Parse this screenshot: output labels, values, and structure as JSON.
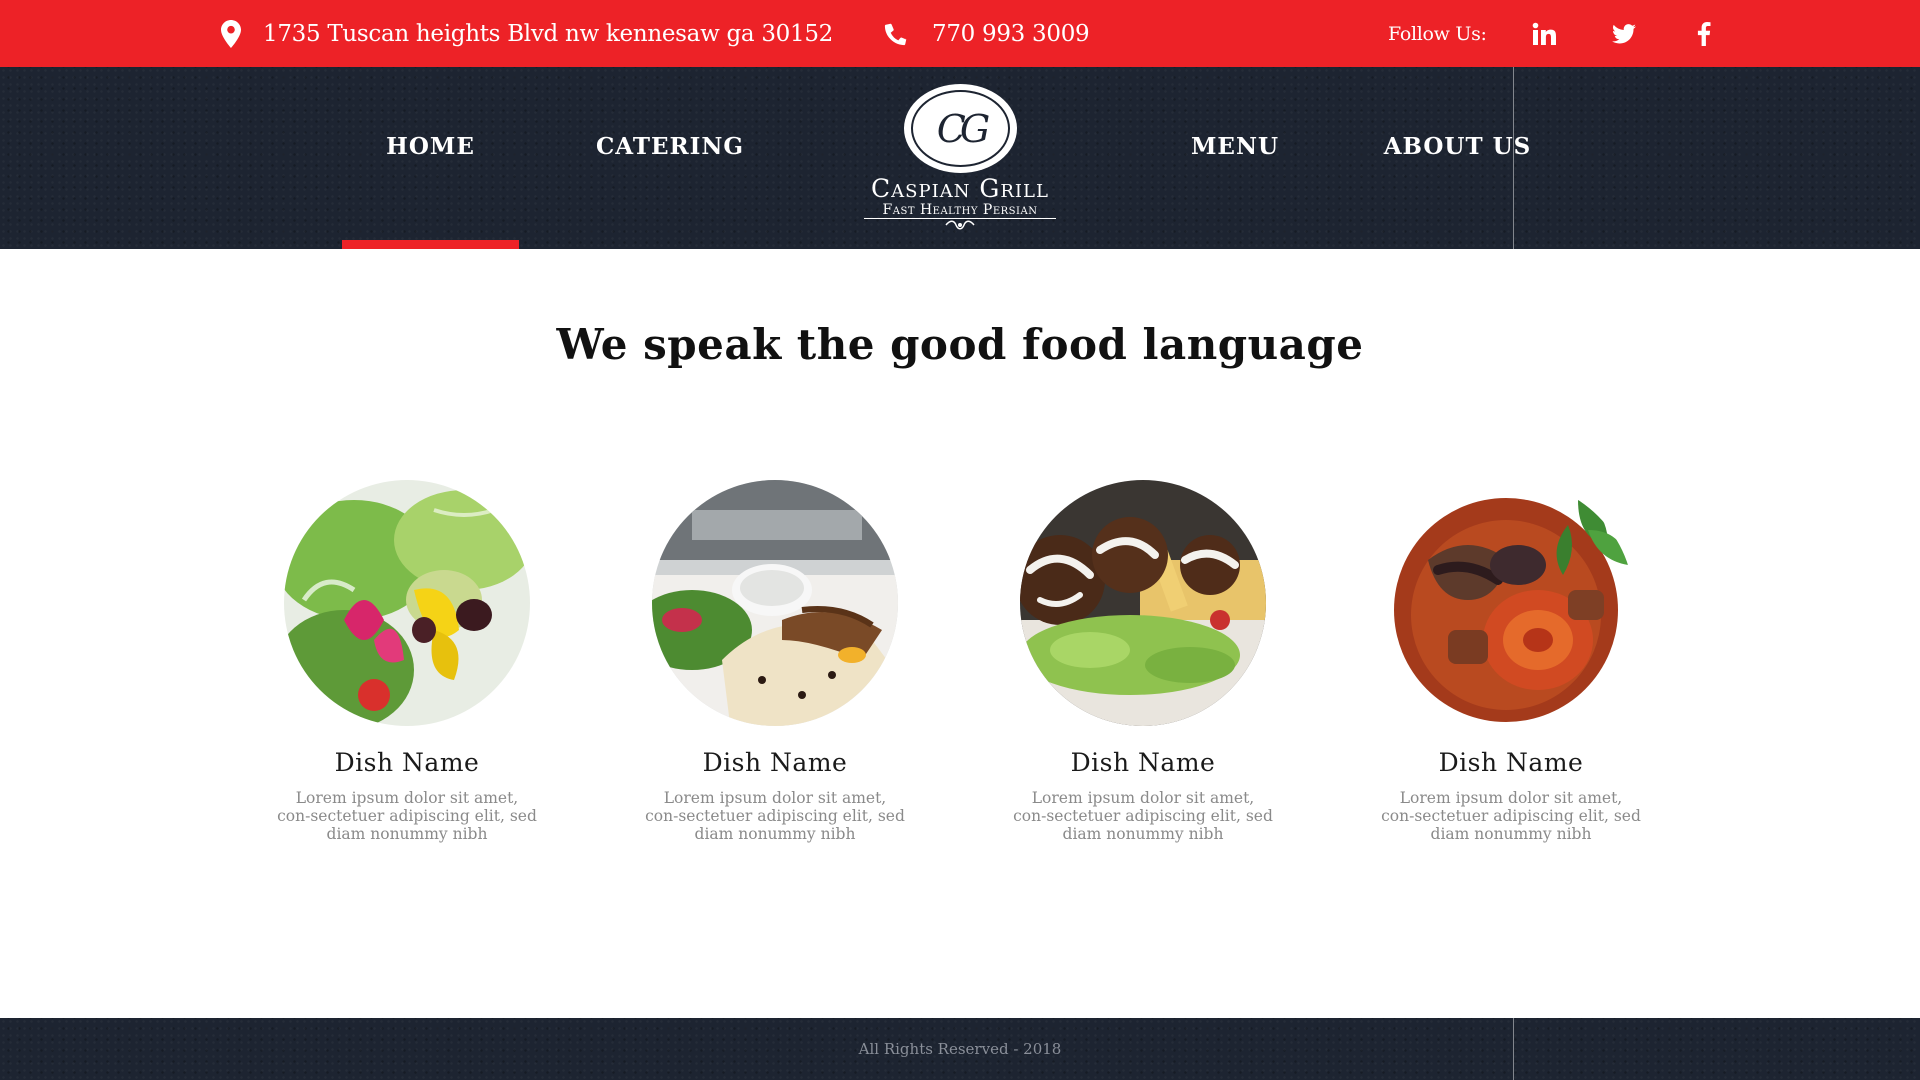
{
  "topbar": {
    "background_color": "#ed2227",
    "address_icon": "map-pin-icon",
    "address": "1735 Tuscan heights Blvd nw kennesaw ga 30152",
    "phone_icon": "phone-icon",
    "phone": "770 993 3009",
    "follow_label": "Follow Us:",
    "social": [
      {
        "icon": "linkedin-icon"
      },
      {
        "icon": "twitter-icon"
      },
      {
        "icon": "facebook-icon"
      }
    ]
  },
  "nav": {
    "background_color": "#1d2431",
    "items": [
      {
        "label": "HOME",
        "active": true
      },
      {
        "label": "CATERING",
        "active": false
      },
      {
        "label": "MENU",
        "active": false
      },
      {
        "label": "ABOUT US",
        "active": false
      }
    ],
    "logo": {
      "monogram": "CG",
      "brand": "Caspian Grill",
      "tagline": "Fast Healthy Persian"
    }
  },
  "main": {
    "headline": "We speak the good food language",
    "dishes": [
      {
        "name": "Dish Name",
        "description": "Lorem ipsum dolor sit amet, con-sectetuer adipiscing elit, sed diam nonummy nibh",
        "image": "salad-photo"
      },
      {
        "name": "Dish Name",
        "description": "Lorem ipsum dolor sit amet, con-sectetuer adipiscing elit, sed diam nonummy nibh",
        "image": "rice-plate-photo"
      },
      {
        "name": "Dish Name",
        "description": "Lorem ipsum dolor sit amet, con-sectetuer adipiscing elit, sed diam nonummy nibh",
        "image": "falafel-photo"
      },
      {
        "name": "Dish Name",
        "description": "Lorem ipsum dolor sit amet, con-sectetuer adipiscing elit, sed diam nonummy nibh",
        "image": "stew-photo"
      }
    ]
  },
  "footer": {
    "copyright": "All Rights Reserved - 2018"
  },
  "colors": {
    "accent": "#ed2227",
    "dark": "#1d2431"
  }
}
